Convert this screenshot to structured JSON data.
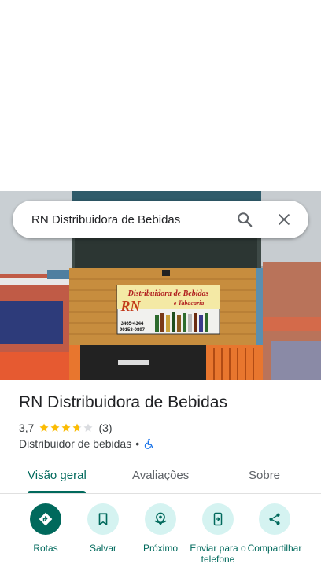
{
  "search": {
    "query": "RN Distribuidora de Bebidas"
  },
  "place": {
    "name": "RN Distribuidora de Bebidas",
    "rating": "3,7",
    "rating_value": 3.7,
    "rating_max": 5,
    "review_count": "(3)",
    "category": "Distribuidor de bebidas",
    "separator": "•",
    "accessibility_icon": "wheelchair-icon"
  },
  "photo": {
    "sign_line1": "Distribuidora de Bebidas",
    "sign_line2": "e Tabacaria",
    "sign_logo": "RN",
    "sign_phone1": "3465-4344",
    "sign_phone2": "99153-0897"
  },
  "tabs": [
    {
      "label": "Visão geral",
      "active": true
    },
    {
      "label": "Avaliações",
      "active": false
    },
    {
      "label": "Sobre",
      "active": false
    }
  ],
  "actions": [
    {
      "label": "Rotas",
      "icon": "directions-icon"
    },
    {
      "label": "Salvar",
      "icon": "bookmark-icon"
    },
    {
      "label": "Próximo",
      "icon": "nearby-icon"
    },
    {
      "label": "Enviar para o telefone",
      "icon": "send-to-phone-icon"
    },
    {
      "label": "Compartilhar",
      "icon": "share-icon"
    }
  ],
  "colors": {
    "accent": "#00695c",
    "accent_light": "#d5f3f1",
    "star": "#fbbc04",
    "star_empty": "#dadce0",
    "accessibility": "#1a73e8"
  }
}
